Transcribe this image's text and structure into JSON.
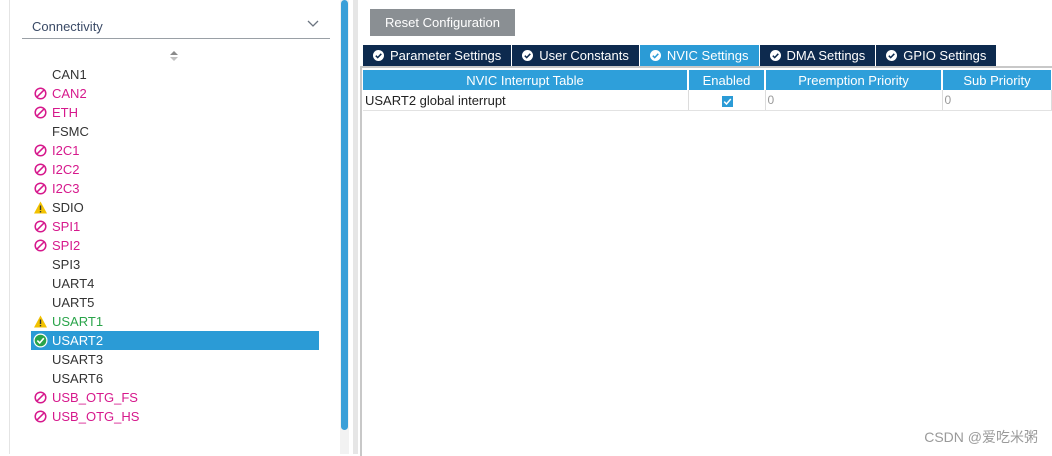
{
  "sidebar": {
    "category": "Connectivity",
    "items": [
      {
        "label": "CAN1",
        "state": "normal"
      },
      {
        "label": "CAN2",
        "state": "disabled"
      },
      {
        "label": "ETH",
        "state": "disabled"
      },
      {
        "label": "FSMC",
        "state": "normal"
      },
      {
        "label": "I2C1",
        "state": "disabled"
      },
      {
        "label": "I2C2",
        "state": "disabled"
      },
      {
        "label": "I2C3",
        "state": "disabled"
      },
      {
        "label": "SDIO",
        "state": "warning"
      },
      {
        "label": "SPI1",
        "state": "disabled"
      },
      {
        "label": "SPI2",
        "state": "disabled"
      },
      {
        "label": "SPI3",
        "state": "normal"
      },
      {
        "label": "UART4",
        "state": "normal"
      },
      {
        "label": "UART5",
        "state": "normal"
      },
      {
        "label": "USART1",
        "state": "warning-green"
      },
      {
        "label": "USART2",
        "state": "selected"
      },
      {
        "label": "USART3",
        "state": "normal"
      },
      {
        "label": "USART6",
        "state": "normal"
      },
      {
        "label": "USB_OTG_FS",
        "state": "disabled"
      },
      {
        "label": "USB_OTG_HS",
        "state": "disabled"
      }
    ]
  },
  "toolbar": {
    "reset_label": "Reset Configuration"
  },
  "tabs": [
    {
      "label": "Parameter Settings",
      "active": false
    },
    {
      "label": "User Constants",
      "active": false
    },
    {
      "label": "NVIC Settings",
      "active": true
    },
    {
      "label": "DMA Settings",
      "active": false
    },
    {
      "label": "GPIO Settings",
      "active": false
    }
  ],
  "nvic_table": {
    "headers": [
      "NVIC Interrupt Table",
      "Enabled",
      "Preemption Priority",
      "Sub Priority"
    ],
    "rows": [
      {
        "name": "USART2 global interrupt",
        "enabled": true,
        "preemption": "0",
        "sub": "0"
      }
    ]
  },
  "watermark": "CSDN @爱吃米粥",
  "colors": {
    "accent": "#2b9bd6",
    "tab_dark": "#0d2a4e",
    "disabled": "#d6188c",
    "warning": "#f2c200",
    "ok_green": "#2aa44a"
  }
}
